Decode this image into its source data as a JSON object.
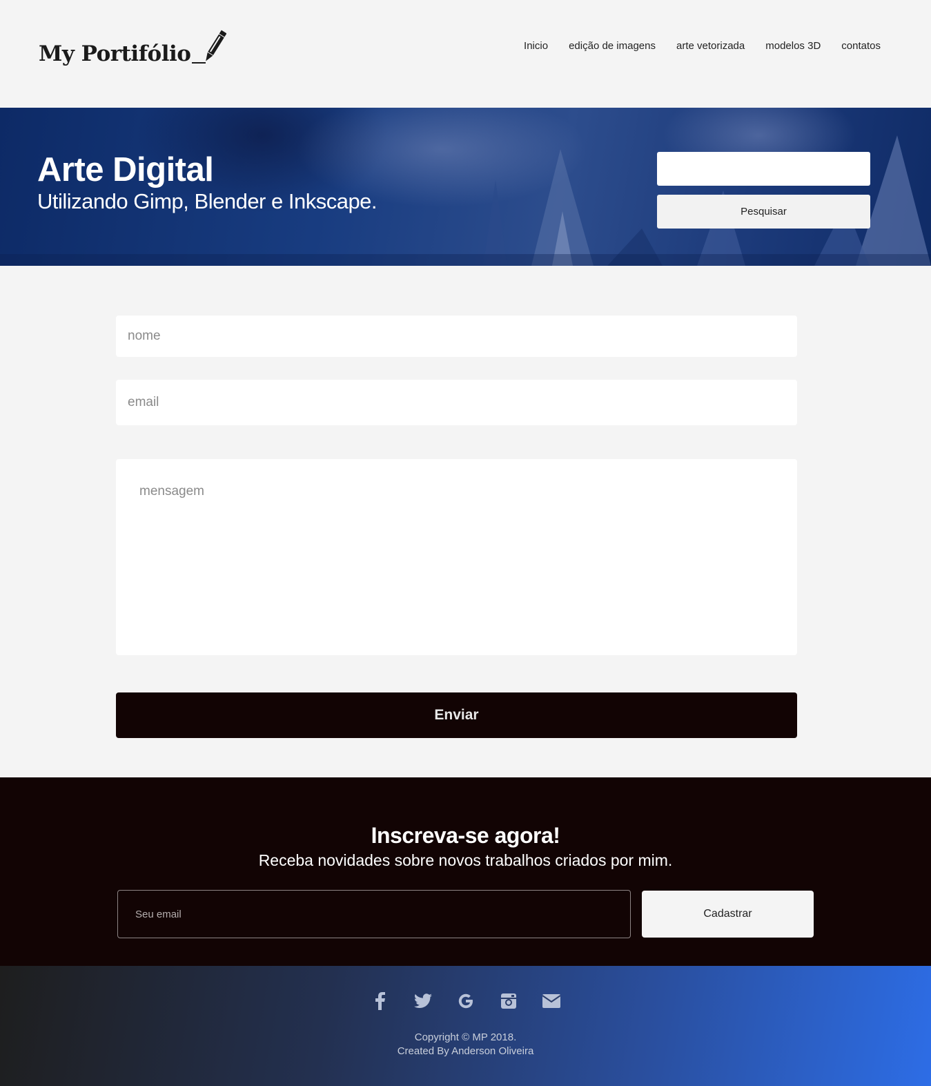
{
  "header": {
    "logo_text": "My Portifólio",
    "nav": [
      {
        "label": "Inicio"
      },
      {
        "label": "edição de imagens"
      },
      {
        "label": "arte vetorizada"
      },
      {
        "label": "modelos 3D"
      },
      {
        "label": "contatos"
      }
    ]
  },
  "hero": {
    "title": "Arte Digital",
    "subtitle": "Utilizando Gimp, Blender e Inkscape.",
    "search_value": "",
    "search_button": "Pesquisar"
  },
  "contact_form": {
    "name_placeholder": "nome",
    "email_placeholder": "email",
    "message_placeholder": "mensagem",
    "submit_label": "Enviar"
  },
  "newsletter": {
    "title": "Inscreva-se agora!",
    "subtitle": "Receba novidades sobre novos trabalhos criados por mim.",
    "email_placeholder": "Seu email",
    "button_label": "Cadastrar"
  },
  "footer": {
    "social": [
      "facebook-icon",
      "twitter-icon",
      "google-icon",
      "instagram-icon",
      "mail-icon"
    ],
    "copyright": "Copyright © MP 2018.",
    "credit": "Created By Anderson Oliveira"
  },
  "colors": {
    "background": "#f4f4f4",
    "dark": "#120404",
    "hero_blue": "#183c80",
    "footer_blue": "#2d6de6"
  }
}
